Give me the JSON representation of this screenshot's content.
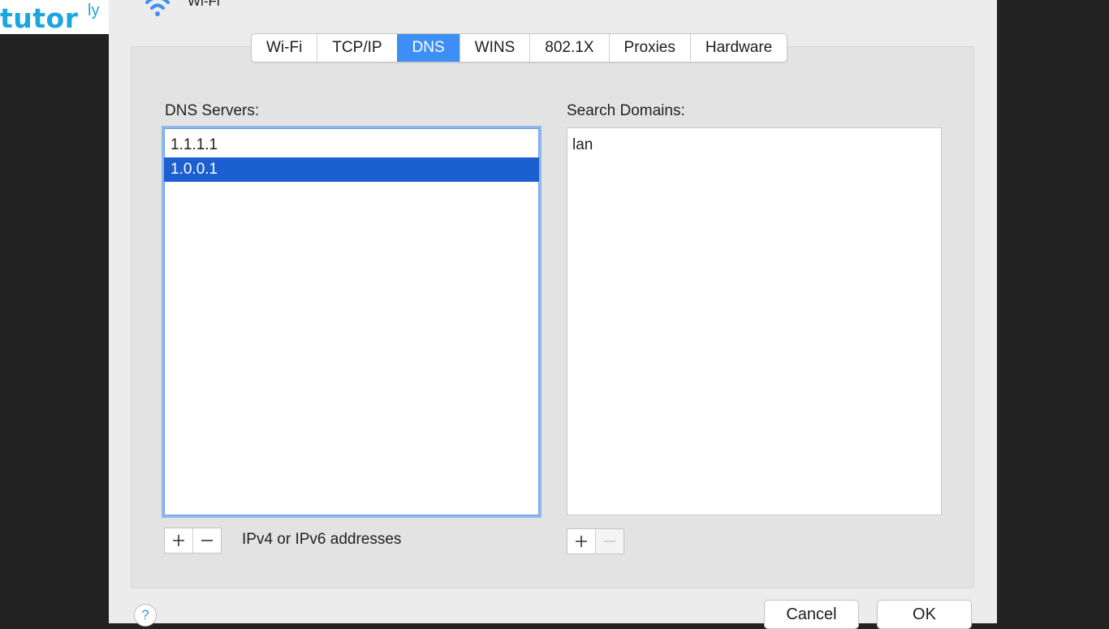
{
  "branding": {
    "logo_text": "tutor",
    "logo_sup": "ly",
    "color": "#1ba6e0"
  },
  "window": {
    "title": "Wi-Fi"
  },
  "tabs": [
    {
      "label": "Wi-Fi"
    },
    {
      "label": "TCP/IP"
    },
    {
      "label": "DNS",
      "active": true
    },
    {
      "label": "WINS"
    },
    {
      "label": "802.1X"
    },
    {
      "label": "Proxies"
    },
    {
      "label": "Hardware"
    }
  ],
  "dns": {
    "label": "DNS Servers:",
    "servers": [
      "1.1.1.1",
      "1.0.0.1"
    ],
    "selected": "1.0.0.1",
    "hint": "IPv4 or IPv6 addresses",
    "add_icon": "plus-icon",
    "remove_icon": "minus-icon"
  },
  "search": {
    "label": "Search Domains:",
    "domains": [
      "lan"
    ],
    "add_icon": "plus-icon",
    "remove_icon": "minus-icon"
  },
  "footer": {
    "help": "?",
    "cancel": "Cancel",
    "ok": "OK"
  },
  "colors": {
    "accent": "#3d8ff5",
    "selection": "#1c5fd1",
    "focus_ring": "#8fb7ec"
  }
}
